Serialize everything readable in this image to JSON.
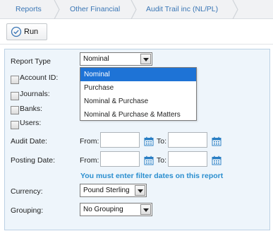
{
  "breadcrumb": {
    "items": [
      "Reports",
      "Other Financial",
      "Audit Trail inc (NL/PL)"
    ]
  },
  "toolbar": {
    "run_label": "Run"
  },
  "form": {
    "report_type_label": "Report Type",
    "report_type_value": "Nominal",
    "account_id_label": "Account ID:",
    "journals_label": "Journals:",
    "banks_label": "Banks:",
    "users_label": "Users:",
    "audit_date_label": "Audit Date:",
    "posting_date_label": "Posting Date:",
    "from_label": "From:",
    "to_label": "To:",
    "warning": "You must enter filter dates on this report",
    "currency_label": "Currency:",
    "currency_value": "Pound Sterling",
    "grouping_label": "Grouping:",
    "grouping_value": "No Grouping"
  },
  "report_type_options": [
    "Nominal",
    "Purchase",
    "Nominal & Purchase",
    "Nominal & Purchase & Matters"
  ],
  "colors": {
    "accent": "#1e73d6",
    "link": "#3a76b5",
    "warning": "#2a8ecf",
    "panel_bg": "#eef5fb",
    "panel_border": "#bcd1e4"
  }
}
